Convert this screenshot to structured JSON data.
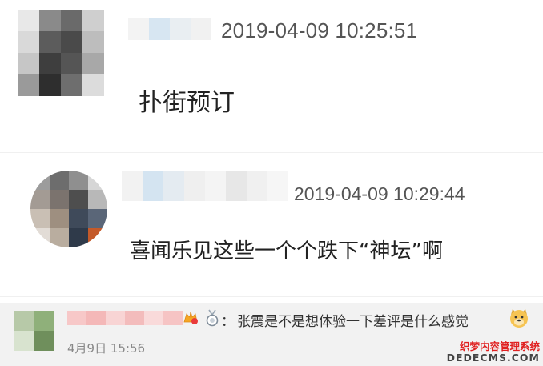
{
  "comments": [
    {
      "timestamp": "2019-04-09 10:25:51",
      "text": "扑街预订"
    },
    {
      "timestamp": "2019-04-09 10:29:44",
      "text": "喜闻乐见这些一个个跌下“神坛”啊"
    }
  ],
  "weibo_comment": {
    "separator": "：",
    "text": "张震是不是想体验一下差评是什么感觉",
    "date": "4月9日 15:56"
  },
  "watermark": {
    "line1": "织梦内容管理系统",
    "line2": "DEDECMS.COM"
  },
  "icons": [
    "avatar-blurred",
    "name-blurred",
    "vip-badge-icon",
    "medal-icon",
    "doge-emoji-icon"
  ],
  "colors": {
    "timestamp": "#555555",
    "text": "#222222",
    "watermark_red": "#e02020",
    "bar_bg": "#f2f2f2"
  }
}
